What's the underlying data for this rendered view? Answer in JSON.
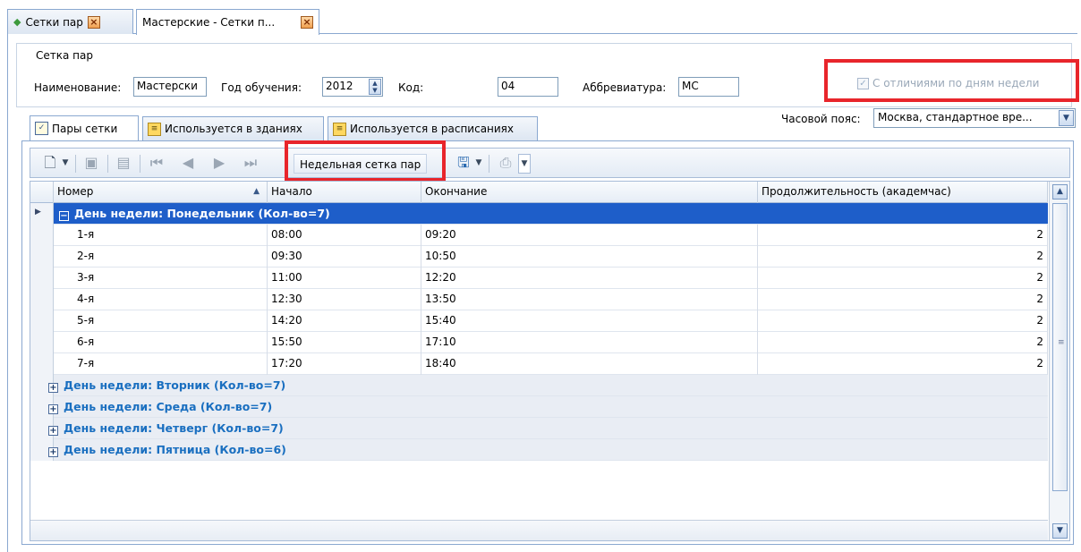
{
  "doc_tabs": [
    {
      "label": "Сетки пар",
      "active": false
    },
    {
      "label": "Мастерские - Сетки п...",
      "active": true
    }
  ],
  "form": {
    "group_title": "Сетка пар",
    "name_label": "Наименование:",
    "name_value": "Мастерски",
    "year_label": "Год обучения:",
    "year_value": "2012",
    "code_label": "Код:",
    "code_value": "04",
    "abbr_label": "Аббревиатура:",
    "abbr_value": "МС",
    "weekday_checkbox_label": "С отличиями по дням недели",
    "timezone_label": "Часовой пояс:",
    "timezone_value": "Москва, стандартное вре..."
  },
  "inner_tabs": [
    {
      "label": "Пары сетки",
      "active": true
    },
    {
      "label": "Используется в зданиях",
      "active": false
    },
    {
      "label": "Используется в расписаниях",
      "active": false
    }
  ],
  "toolbar": {
    "weekly_grid_label": "Недельная сетка пар"
  },
  "grid": {
    "columns": [
      "Номер",
      "Начало",
      "Окончание",
      "Продолжительность (академчас)"
    ],
    "expanded_group": "День недели: Понедельник (Кол-во=7)",
    "rows": [
      {
        "number": "1-я",
        "start": "08:00",
        "end": "09:20",
        "duration": "2"
      },
      {
        "number": "2-я",
        "start": "09:30",
        "end": "10:50",
        "duration": "2"
      },
      {
        "number": "3-я",
        "start": "11:00",
        "end": "12:20",
        "duration": "2"
      },
      {
        "number": "4-я",
        "start": "12:30",
        "end": "13:50",
        "duration": "2"
      },
      {
        "number": "5-я",
        "start": "14:20",
        "end": "15:40",
        "duration": "2"
      },
      {
        "number": "6-я",
        "start": "15:50",
        "end": "17:10",
        "duration": "2"
      },
      {
        "number": "7-я",
        "start": "17:20",
        "end": "18:40",
        "duration": "2"
      }
    ],
    "collapsed_groups": [
      "День недели: Вторник (Кол-во=7)",
      "День недели: Среда (Кол-во=7)",
      "День недели: Четверг (Кол-во=7)",
      "День недели: Пятница (Кол-во=6)"
    ]
  },
  "colors": {
    "highlight_red": "#e8252b",
    "selection_blue": "#1e5ec9",
    "group_text_blue": "#1a6fc0"
  }
}
